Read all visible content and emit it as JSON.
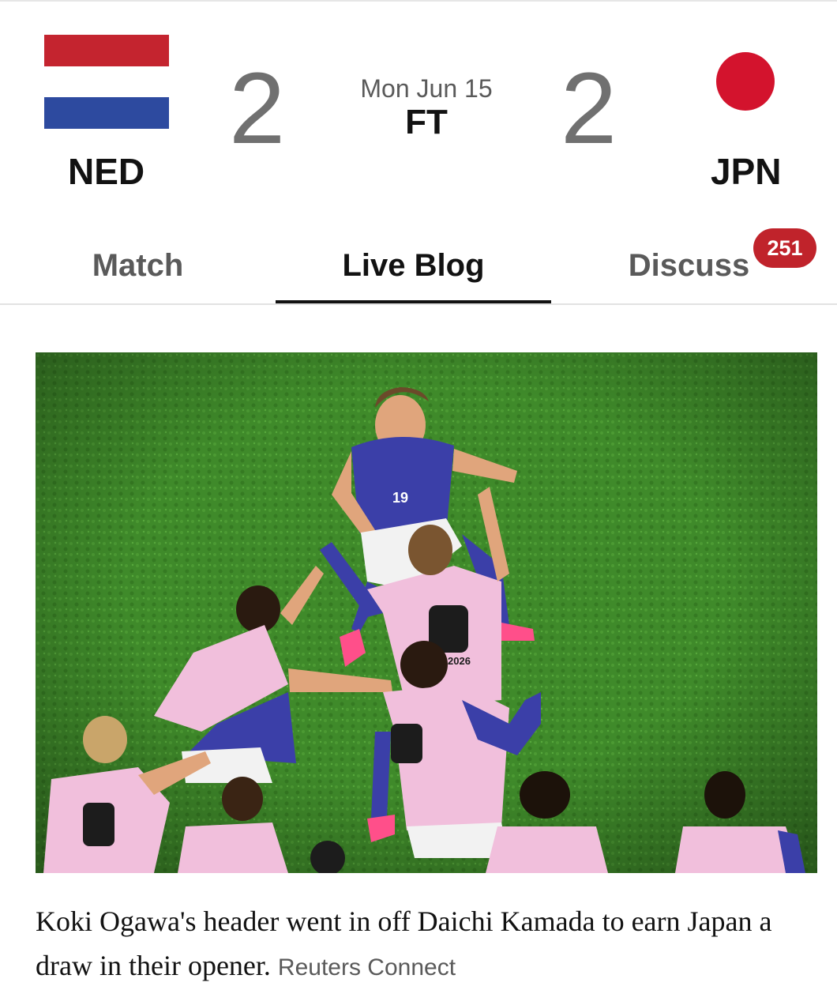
{
  "scoreboard": {
    "home": {
      "code": "NED",
      "score": "2",
      "flag_icon": "netherlands-flag-icon",
      "flag_colors": [
        "#c4242f",
        "#ffffff",
        "#2d4a9f"
      ]
    },
    "away": {
      "code": "JPN",
      "score": "2",
      "flag_icon": "japan-flag-icon",
      "flag_colors": [
        "#ffffff",
        "#d3132d"
      ]
    },
    "date": "Mon Jun 15",
    "status": "FT"
  },
  "tabs": [
    {
      "label": "Match",
      "active": false
    },
    {
      "label": "Live Blog",
      "active": true
    },
    {
      "label": "Discuss",
      "active": false,
      "badge": "251"
    }
  ],
  "photo": {
    "caption": "Koki Ogawa's header went in off Daichi Kamada to earn Japan a draw in their opener.",
    "credit": "Reuters Connect"
  },
  "colors": {
    "accent": "#c0232b",
    "text": "#121212",
    "muted": "#5a5a5a",
    "pitch": "#3f8a2a",
    "bib": "#f1bfdc",
    "kit": "#3b3fa8"
  }
}
